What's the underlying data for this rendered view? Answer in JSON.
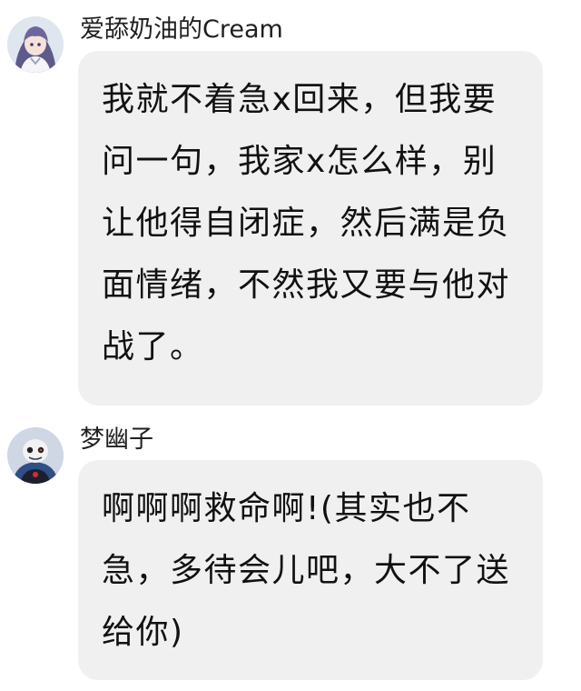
{
  "messages": [
    {
      "sender": "爱舔奶油的Cream",
      "avatar_icon": "anime-girl-avatar",
      "text": "我就不着急x回来，但我要问一句，我家x怎么样，别让他得自闭症，然后满是负面情绪，不然我又要与他对战了。"
    },
    {
      "sender": "梦幽子",
      "avatar_icon": "skeleton-character-avatar",
      "text": "啊啊啊救命啊!(其实也不急，多待会儿吧，大不了送给你)"
    }
  ],
  "colors": {
    "bubble": "#f0f0f0",
    "text": "#111111",
    "background": "#ffffff"
  }
}
